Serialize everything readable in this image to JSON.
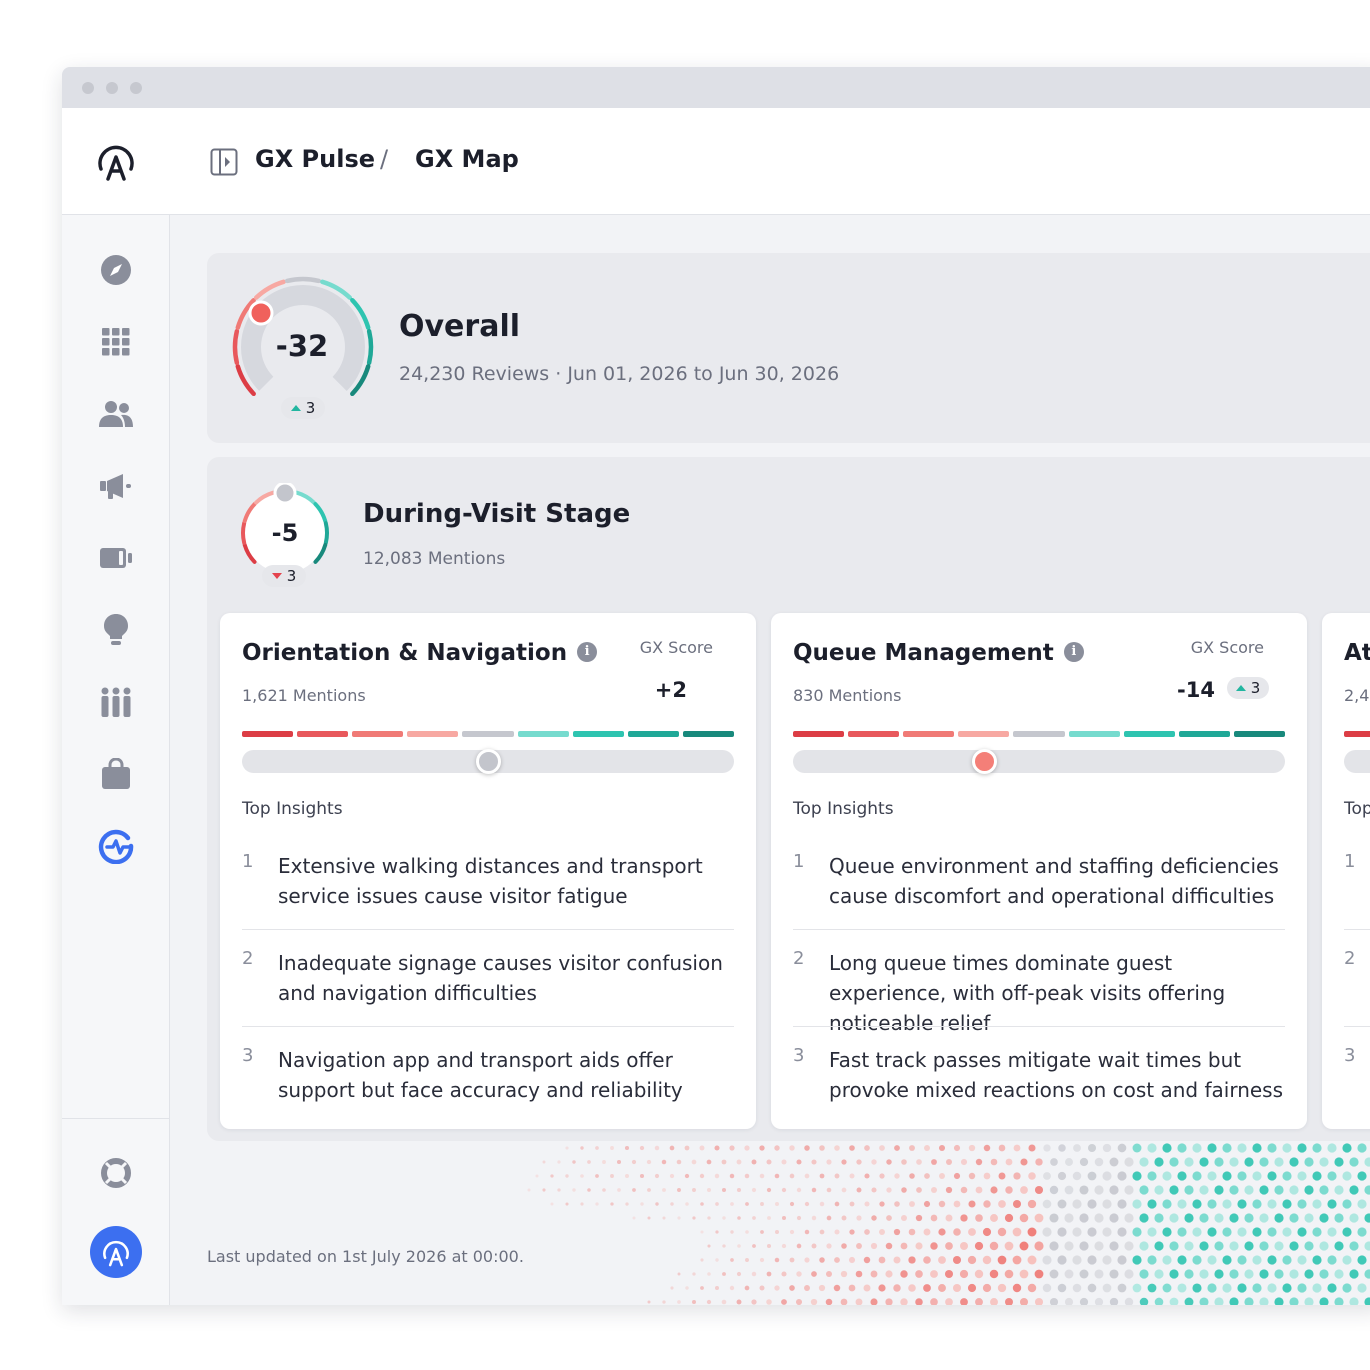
{
  "breadcrumb": {
    "app": "GX Pulse",
    "separator": "/",
    "page": "GX Map"
  },
  "sidebar": {
    "items": [
      {
        "icon": "compass-icon"
      },
      {
        "icon": "grid-icon"
      },
      {
        "icon": "users-icon"
      },
      {
        "icon": "megaphone-icon"
      },
      {
        "icon": "device-icon"
      },
      {
        "icon": "lightbulb-icon"
      },
      {
        "icon": "people-group-icon"
      },
      {
        "icon": "bag-icon"
      },
      {
        "icon": "gx-logo-icon",
        "active": true
      }
    ],
    "bottom": [
      {
        "icon": "lifebuoy-icon"
      },
      {
        "icon": "account-avatar-icon"
      }
    ]
  },
  "overall": {
    "score": "-32",
    "delta": "3",
    "delta_direction": "up",
    "title": "Overall",
    "subtitle": "24,230 Reviews · Jun 01, 2026 to Jun 30, 2026"
  },
  "stage": {
    "score": "-5",
    "delta": "3",
    "delta_direction": "down",
    "title": "During-Visit Stage",
    "subtitle": "12,083 Mentions"
  },
  "cards": [
    {
      "title": "Orientation & Navigation",
      "mentions": "1,621 Mentions",
      "score_label": "GX Score",
      "score": "+2",
      "insights_title": "Top Insights",
      "knob_position": 0.5,
      "knob_color": "#c3c5cc",
      "insights": [
        {
          "num": "1",
          "text": "Extensive walking distances and transport service issues cause visitor fatigue"
        },
        {
          "num": "2",
          "text": "Inadequate signage causes visitor confusion and navigation difficulties"
        },
        {
          "num": "3",
          "text": "Navigation app and transport aids offer support but face accuracy and reliability"
        }
      ]
    },
    {
      "title": "Queue Management",
      "mentions": "830 Mentions",
      "score_label": "GX Score",
      "score": "-14",
      "delta": "3",
      "delta_direction": "up",
      "insights_title": "Top Insights",
      "knob_position": 0.39,
      "knob_color": "#f47f78",
      "insights": [
        {
          "num": "1",
          "text": "Queue environment and staffing deficiencies cause discomfort and operational difficulties"
        },
        {
          "num": "2",
          "text": "Long queue times dominate guest experience, with off-peak visits offering noticeable relief"
        },
        {
          "num": "3",
          "text": "Fast track passes mitigate wait times but provoke mixed reactions on cost and fairness"
        }
      ]
    },
    {
      "title": "At",
      "mentions": "2,4",
      "insights_title": "Top",
      "insights": [
        {
          "num": "1"
        },
        {
          "num": "2"
        },
        {
          "num": "3"
        }
      ]
    }
  ],
  "scale_colors": [
    "#dc3d45",
    "#e8585c",
    "#f07a76",
    "#f7a8a2",
    "#c5c7ce",
    "#76dbce",
    "#2ec4b0",
    "#1fa897",
    "#18897c"
  ],
  "footer": "Last updated on 1st July 2026 at 00:00."
}
